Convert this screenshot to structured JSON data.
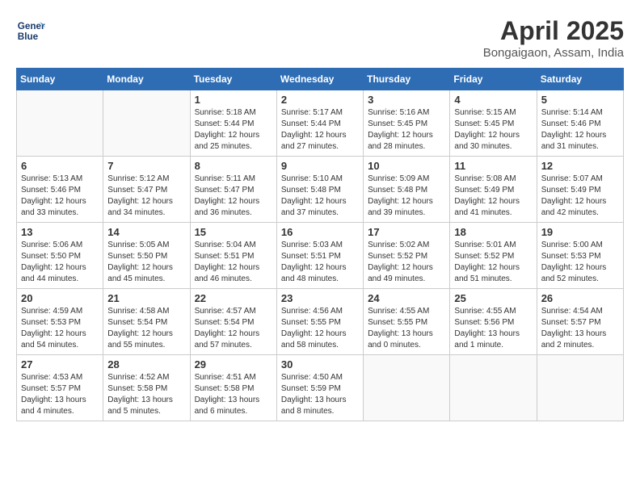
{
  "header": {
    "logo_line1": "General",
    "logo_line2": "Blue",
    "month_year": "April 2025",
    "location": "Bongaigaon, Assam, India"
  },
  "days_of_week": [
    "Sunday",
    "Monday",
    "Tuesday",
    "Wednesday",
    "Thursday",
    "Friday",
    "Saturday"
  ],
  "weeks": [
    [
      {
        "day": "",
        "info": ""
      },
      {
        "day": "",
        "info": ""
      },
      {
        "day": "1",
        "info": "Sunrise: 5:18 AM\nSunset: 5:44 PM\nDaylight: 12 hours and 25 minutes."
      },
      {
        "day": "2",
        "info": "Sunrise: 5:17 AM\nSunset: 5:44 PM\nDaylight: 12 hours and 27 minutes."
      },
      {
        "day": "3",
        "info": "Sunrise: 5:16 AM\nSunset: 5:45 PM\nDaylight: 12 hours and 28 minutes."
      },
      {
        "day": "4",
        "info": "Sunrise: 5:15 AM\nSunset: 5:45 PM\nDaylight: 12 hours and 30 minutes."
      },
      {
        "day": "5",
        "info": "Sunrise: 5:14 AM\nSunset: 5:46 PM\nDaylight: 12 hours and 31 minutes."
      }
    ],
    [
      {
        "day": "6",
        "info": "Sunrise: 5:13 AM\nSunset: 5:46 PM\nDaylight: 12 hours and 33 minutes."
      },
      {
        "day": "7",
        "info": "Sunrise: 5:12 AM\nSunset: 5:47 PM\nDaylight: 12 hours and 34 minutes."
      },
      {
        "day": "8",
        "info": "Sunrise: 5:11 AM\nSunset: 5:47 PM\nDaylight: 12 hours and 36 minutes."
      },
      {
        "day": "9",
        "info": "Sunrise: 5:10 AM\nSunset: 5:48 PM\nDaylight: 12 hours and 37 minutes."
      },
      {
        "day": "10",
        "info": "Sunrise: 5:09 AM\nSunset: 5:48 PM\nDaylight: 12 hours and 39 minutes."
      },
      {
        "day": "11",
        "info": "Sunrise: 5:08 AM\nSunset: 5:49 PM\nDaylight: 12 hours and 41 minutes."
      },
      {
        "day": "12",
        "info": "Sunrise: 5:07 AM\nSunset: 5:49 PM\nDaylight: 12 hours and 42 minutes."
      }
    ],
    [
      {
        "day": "13",
        "info": "Sunrise: 5:06 AM\nSunset: 5:50 PM\nDaylight: 12 hours and 44 minutes."
      },
      {
        "day": "14",
        "info": "Sunrise: 5:05 AM\nSunset: 5:50 PM\nDaylight: 12 hours and 45 minutes."
      },
      {
        "day": "15",
        "info": "Sunrise: 5:04 AM\nSunset: 5:51 PM\nDaylight: 12 hours and 46 minutes."
      },
      {
        "day": "16",
        "info": "Sunrise: 5:03 AM\nSunset: 5:51 PM\nDaylight: 12 hours and 48 minutes."
      },
      {
        "day": "17",
        "info": "Sunrise: 5:02 AM\nSunset: 5:52 PM\nDaylight: 12 hours and 49 minutes."
      },
      {
        "day": "18",
        "info": "Sunrise: 5:01 AM\nSunset: 5:52 PM\nDaylight: 12 hours and 51 minutes."
      },
      {
        "day": "19",
        "info": "Sunrise: 5:00 AM\nSunset: 5:53 PM\nDaylight: 12 hours and 52 minutes."
      }
    ],
    [
      {
        "day": "20",
        "info": "Sunrise: 4:59 AM\nSunset: 5:53 PM\nDaylight: 12 hours and 54 minutes."
      },
      {
        "day": "21",
        "info": "Sunrise: 4:58 AM\nSunset: 5:54 PM\nDaylight: 12 hours and 55 minutes."
      },
      {
        "day": "22",
        "info": "Sunrise: 4:57 AM\nSunset: 5:54 PM\nDaylight: 12 hours and 57 minutes."
      },
      {
        "day": "23",
        "info": "Sunrise: 4:56 AM\nSunset: 5:55 PM\nDaylight: 12 hours and 58 minutes."
      },
      {
        "day": "24",
        "info": "Sunrise: 4:55 AM\nSunset: 5:55 PM\nDaylight: 13 hours and 0 minutes."
      },
      {
        "day": "25",
        "info": "Sunrise: 4:55 AM\nSunset: 5:56 PM\nDaylight: 13 hours and 1 minute."
      },
      {
        "day": "26",
        "info": "Sunrise: 4:54 AM\nSunset: 5:57 PM\nDaylight: 13 hours and 2 minutes."
      }
    ],
    [
      {
        "day": "27",
        "info": "Sunrise: 4:53 AM\nSunset: 5:57 PM\nDaylight: 13 hours and 4 minutes."
      },
      {
        "day": "28",
        "info": "Sunrise: 4:52 AM\nSunset: 5:58 PM\nDaylight: 13 hours and 5 minutes."
      },
      {
        "day": "29",
        "info": "Sunrise: 4:51 AM\nSunset: 5:58 PM\nDaylight: 13 hours and 6 minutes."
      },
      {
        "day": "30",
        "info": "Sunrise: 4:50 AM\nSunset: 5:59 PM\nDaylight: 13 hours and 8 minutes."
      },
      {
        "day": "",
        "info": ""
      },
      {
        "day": "",
        "info": ""
      },
      {
        "day": "",
        "info": ""
      }
    ]
  ]
}
